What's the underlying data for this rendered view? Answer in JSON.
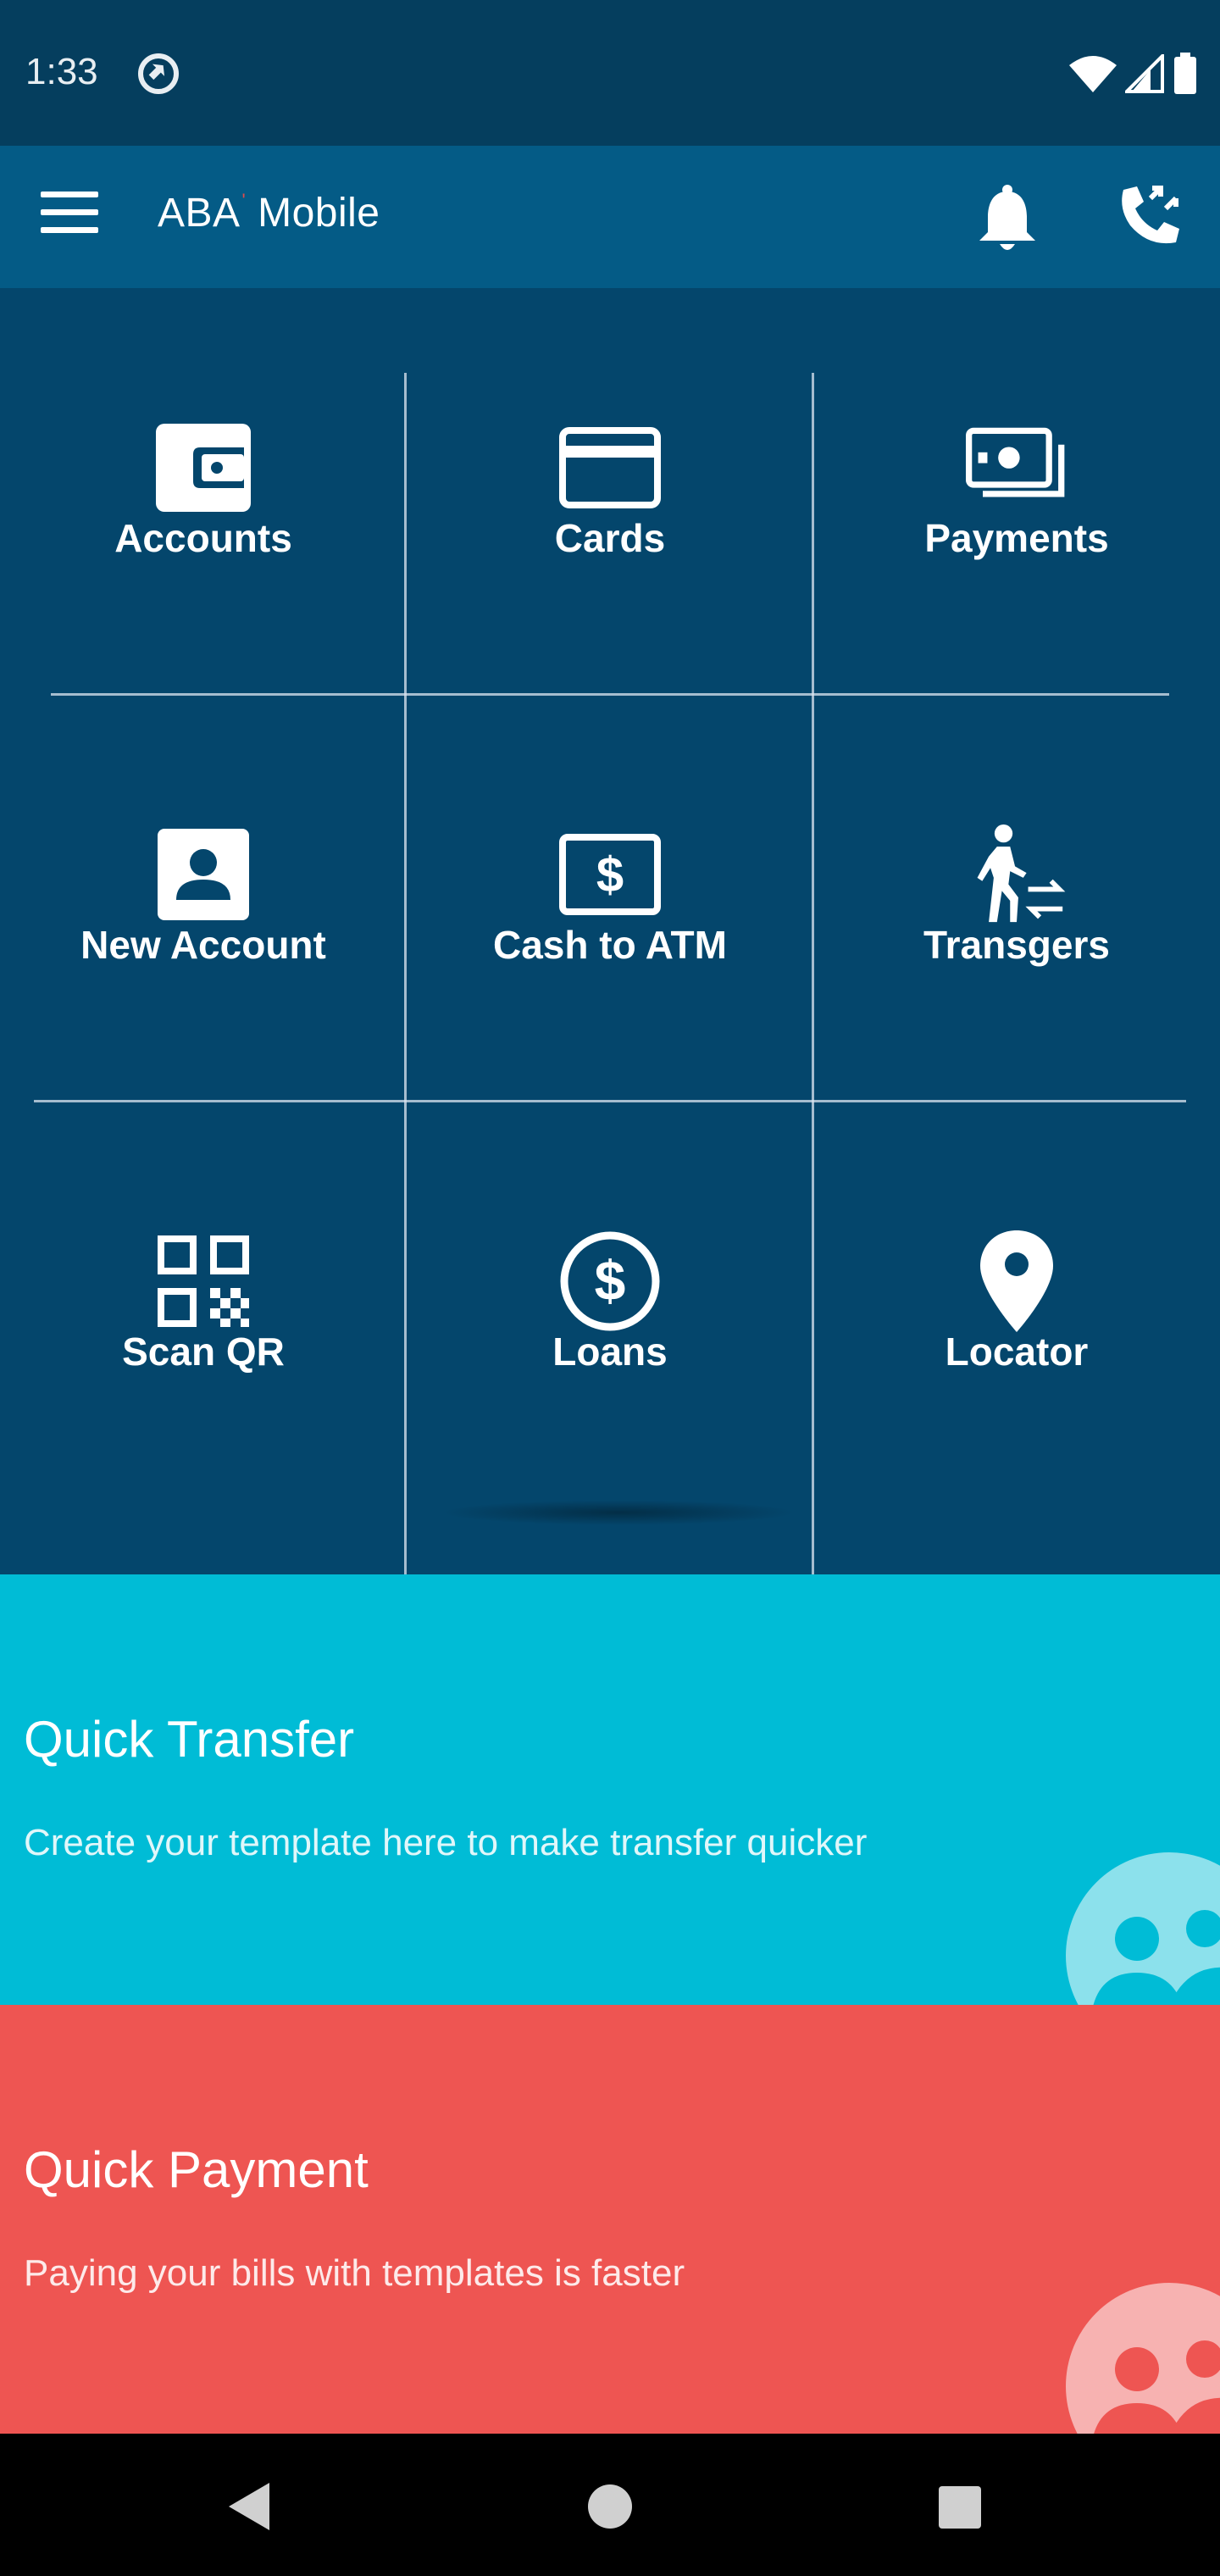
{
  "status_bar": {
    "time": "1:33",
    "icons": [
      "sync-icon",
      "wifi-icon",
      "signal-icon",
      "battery-icon"
    ]
  },
  "app_bar": {
    "title": "ABA",
    "title_mark": "'",
    "title_suffix": "Mobile",
    "icons": [
      "menu-icon",
      "bell-icon",
      "phone-call-icon"
    ]
  },
  "grid": {
    "tiles": [
      {
        "label": "Accounts",
        "icon": "wallet-icon"
      },
      {
        "label": "Cards",
        "icon": "credit-card-icon"
      },
      {
        "label": "Payments",
        "icon": "cash-stack-icon"
      },
      {
        "label": "New Account",
        "icon": "contact-card-icon"
      },
      {
        "label": "Cash to ATM",
        "icon": "dollar-bill-icon"
      },
      {
        "label": "Transgers",
        "icon": "walking-transfer-icon"
      },
      {
        "label": "Scan QR",
        "icon": "qr-code-icon"
      },
      {
        "label": "Loans",
        "icon": "dollar-circle-icon"
      },
      {
        "label": "Locator",
        "icon": "map-pin-icon"
      }
    ]
  },
  "cards": {
    "transfer": {
      "title": "Quick Transfer",
      "description": "Create your template here to make transfer quicker",
      "color": "#00bcd6",
      "icon": "people-icon"
    },
    "payment": {
      "title": "Quick Payment",
      "description": "Paying your bills with templates is faster",
      "color": "#ee5552",
      "icon": "people-icon"
    }
  },
  "nav_bar": {
    "icons": [
      "back-icon",
      "home-icon",
      "recents-icon"
    ]
  },
  "colors": {
    "status_bar": "#053e5e",
    "app_bar": "#045b86",
    "grid_bg": "#04466c"
  }
}
